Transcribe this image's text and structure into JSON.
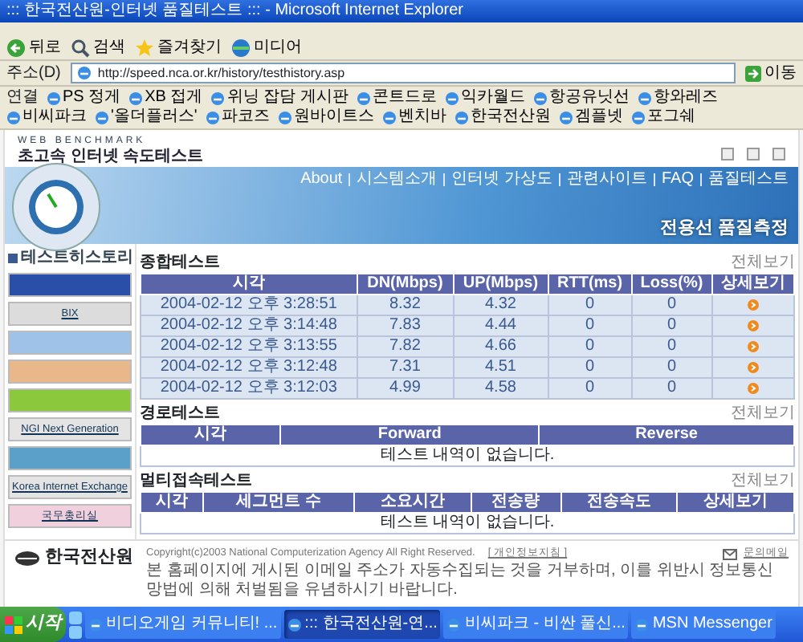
{
  "window": {
    "title": "::: 한국전산원-인터넷 품질테스트 ::: - Microsoft Internet Explorer"
  },
  "toolbar": [
    {
      "label": "뒤로",
      "kind": "back"
    },
    {
      "label": "검색",
      "kind": "search"
    },
    {
      "label": "즐겨찾기",
      "kind": "star"
    },
    {
      "label": "미디어",
      "kind": "media"
    }
  ],
  "address": {
    "label": "주소(D)",
    "value": "http://speed.nca.or.kr/history/testhistory.asp",
    "go": "이동"
  },
  "links": {
    "label": "연결",
    "items": [
      "PS 정게",
      "XB 접게",
      "위닝 잡담 게시판",
      "콘트드로",
      "익카월드",
      "항공유닛선",
      "항와레즈",
      "비씨파크",
      "'올더플러스'",
      "파코즈",
      "원바이트스",
      "벤치바",
      "한국전산원",
      "겜플넷",
      "포그쉐"
    ]
  },
  "page": {
    "brand_small": "WEB BENCHMARK",
    "brand": "초고속 인터넷 속도테스트",
    "nav": [
      "About",
      "시스템소개",
      "인터넷 가상도",
      "관련사이트",
      "FAQ",
      "품질테스트"
    ],
    "banner_title": "전용선 품질측정",
    "sidebar": {
      "title": "테스트히스토리",
      "banners": [
        {
          "color": "#2a4fa8"
        },
        {
          "text": "BIX",
          "color": "#dcdcdc"
        },
        {
          "color": "#9fc3e8"
        },
        {
          "color": "#e8b88a"
        },
        {
          "color": "#8cc83c"
        },
        {
          "text": "NGI Next Generation",
          "color": "#e4e4e4"
        },
        {
          "color": "#5aa0c8"
        },
        {
          "text": "Korea Internet Exchange",
          "color": "#e4e4e4"
        },
        {
          "text": "국무총리실",
          "color": "#f0d0dc"
        }
      ]
    },
    "sections": [
      {
        "title": "종합테스트",
        "more": "전체보기",
        "columns": [
          "시각",
          "DN(Mbps)",
          "UP(Mbps)",
          "RTT(ms)",
          "Loss(%)",
          "상세보기"
        ],
        "rows": [
          {
            "cells": [
              "2004-02-12 오후 3:28:51",
              "8.32",
              "4.32",
              "0",
              "0"
            ],
            "detail": true
          },
          {
            "cells": [
              "2004-02-12 오후 3:14:48",
              "7.83",
              "4.44",
              "0",
              "0"
            ],
            "detail": true
          },
          {
            "cells": [
              "2004-02-12 오후 3:13:55",
              "7.82",
              "4.66",
              "0",
              "0"
            ],
            "detail": true
          },
          {
            "cells": [
              "2004-02-12 오후 3:12:48",
              "7.31",
              "4.51",
              "0",
              "0"
            ],
            "detail": true
          },
          {
            "cells": [
              "2004-02-12 오후 3:12:03",
              "4.99",
              "4.58",
              "0",
              "0"
            ],
            "detail": true
          }
        ]
      },
      {
        "title": "경로테스트",
        "more": "전체보기",
        "columns": [
          "시각",
          "Forward",
          "Reverse"
        ],
        "empty": "테스트 내역이 없습니다."
      },
      {
        "title": "멀티접속테스트",
        "more": "전체보기",
        "columns": [
          "시각",
          "세그먼트 수",
          "소요시간",
          "전송량",
          "전송속도",
          "상세보기"
        ],
        "empty": "테스트 내역이 없습니다."
      }
    ],
    "footer": {
      "logo": "한국전산원",
      "copyright": "Copyright(c)2003 National Computerization Agency All Right Reserved.",
      "privacy": "[ 개인정보지침 ]",
      "mail": "문의메일",
      "notice": "본 홈페이지에 게시된 이메일 주소가 자동수집되는 것을 거부하며, 이를 위반시 정보통신망법에 의해 처벌됨을 유념하시기 바랍니다."
    }
  },
  "taskbar": {
    "start": "시작",
    "items": [
      {
        "label": "비디오게임 커뮤니티! ...",
        "selected": false
      },
      {
        "label": "::: 한국전산원-연...",
        "selected": true
      },
      {
        "label": "비씨파크 - 비싼 풀신...",
        "selected": false
      },
      {
        "label": "MSN Messenger",
        "selected": false
      }
    ]
  }
}
